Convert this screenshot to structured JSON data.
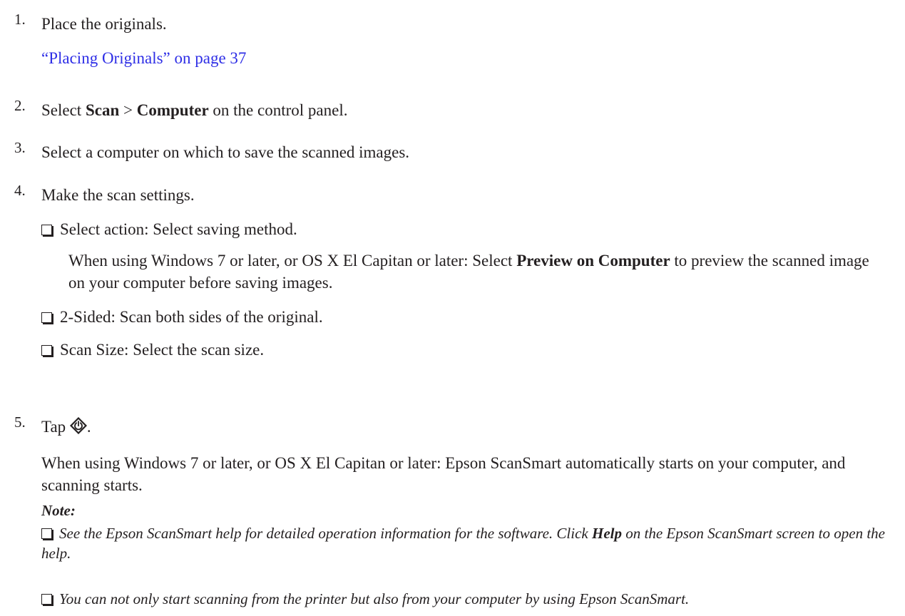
{
  "steps": [
    {
      "num": "1.",
      "text": "Place the originals.",
      "link": "“Placing Originals” on page 37"
    },
    {
      "num": "2.",
      "pre": "Select ",
      "b1": "Scan",
      "mid": " > ",
      "b2": "Computer",
      "post": " on the control panel."
    },
    {
      "num": "3.",
      "text": "Select a computer on which to save the scanned images."
    },
    {
      "num": "4.",
      "text": "Make the scan settings.",
      "options": [
        {
          "text": "Select action: Select saving method.",
          "detail_pre": "When using Windows 7 or later, or OS X El Capitan or later: Select ",
          "detail_bold": "Preview on Computer",
          "detail_post": " to preview the scanned image on your computer before saving images."
        },
        {
          "text": "2-Sided: Scan both sides of the original."
        },
        {
          "text": "Scan Size: Select the scan size."
        }
      ]
    },
    {
      "num": "5.",
      "pre": "Tap ",
      "post": ".",
      "detail": "When using Windows 7 or later, or OS X El Capitan or later: Epson ScanSmart automatically starts on your computer, and scanning starts."
    }
  ],
  "note": {
    "heading": "Note:",
    "items": [
      {
        "pre": "See the Epson ScanSmart help for detailed operation information for the software. Click ",
        "bold": "Help",
        "post": " on the Epson ScanSmart screen to open the help."
      },
      {
        "text": "You can not only start scanning from the printer but also from your computer by using Epson ScanSmart."
      }
    ]
  },
  "icons": {
    "start": "start-diamond-icon"
  }
}
